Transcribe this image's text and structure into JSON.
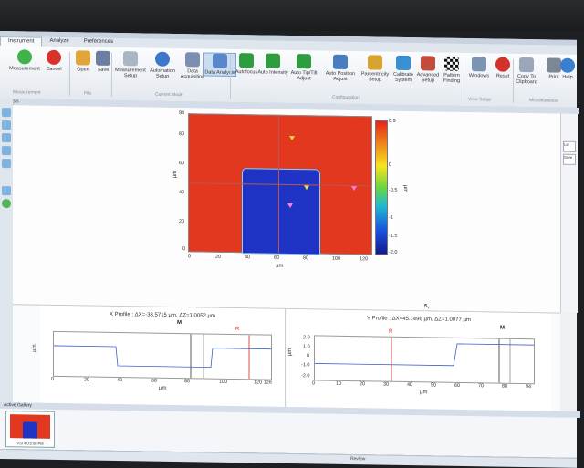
{
  "ribbon": {
    "tabs": [
      "Instrument",
      "Analyze",
      "Preferences"
    ],
    "buttons": [
      {
        "id": "measurement",
        "label": "Measurement"
      },
      {
        "id": "cancel",
        "label": "Cancel"
      },
      {
        "id": "open",
        "label": "Open"
      },
      {
        "id": "save",
        "label": "Save"
      },
      {
        "id": "measurement-setup",
        "label": "Measurement Setup"
      },
      {
        "id": "automation-setup",
        "label": "Automation Setup"
      },
      {
        "id": "data-acquisition",
        "label": "Data Acquisition"
      },
      {
        "id": "data-analysis",
        "label": "Data Analysis"
      },
      {
        "id": "autofocus",
        "label": "Autofocus"
      },
      {
        "id": "auto-intensity",
        "label": "Auto Intensity"
      },
      {
        "id": "auto-tip-tilt",
        "label": "Auto Tip/Tilt Adjust"
      },
      {
        "id": "auto-position",
        "label": "Auto Position Adjust"
      },
      {
        "id": "parcentricity",
        "label": "Parcentricity Setup"
      },
      {
        "id": "calibrate",
        "label": "Calibrate System"
      },
      {
        "id": "advanced-setup",
        "label": "Advanced Setup"
      },
      {
        "id": "pattern-finding",
        "label": "Pattern Finding"
      },
      {
        "id": "windows",
        "label": "Windows"
      },
      {
        "id": "reset",
        "label": "Reset"
      },
      {
        "id": "copy-clipboard",
        "label": "Copy To Clipboard"
      },
      {
        "id": "print",
        "label": "Print"
      },
      {
        "id": "help",
        "label": "Help"
      }
    ],
    "groups": [
      "Measurement",
      "File",
      "Current Mode",
      "Configuration",
      "View Setup",
      "Miscellaneous"
    ]
  },
  "view_header": "Analysis",
  "right_panel": {
    "btn1": "Lat",
    "btn2": "Save"
  },
  "heatmap": {
    "y_axis_label": "µm",
    "x_axis_label": "µm",
    "y_ticks": [
      "94",
      "80",
      "60",
      "40",
      "20",
      "0"
    ],
    "x_ticks": [
      "0",
      "20",
      "40",
      "60",
      "80",
      "100",
      "120"
    ],
    "colorbar_ticks": [
      "0.9",
      "0",
      "-0.5",
      "-1",
      "-1.5",
      "-2.0"
    ],
    "colorbar_label": "µm"
  },
  "x_profile": {
    "title": "X Profile : ΔX=-33.5715 µm, ΔZ=1.0052 µm",
    "x_ticks": [
      "0",
      "20",
      "40",
      "60",
      "80",
      "100",
      "120 126"
    ],
    "y_ticks": [
      "0.5",
      "0",
      "-0.5",
      "-1.0",
      "-1.5",
      "-2.0"
    ],
    "x_label": "µm",
    "y_label": "µm",
    "marker_m": "M",
    "marker_r": "R"
  },
  "y_profile": {
    "title": "Y Profile : ΔX=45.1496 µm, ΔZ=1.0077 µm",
    "x_ticks": [
      "0",
      "10",
      "20",
      "30",
      "40",
      "50",
      "60",
      "70",
      "80",
      "94"
    ],
    "y_ticks": [
      "2.0",
      "1.5",
      "1.0",
      "0.5",
      "0",
      "-0.5",
      "-1.0",
      "-1.5",
      "-2.0"
    ],
    "x_label": "µm",
    "y_label": "µm",
    "marker_m": "M",
    "marker_r": "R"
  },
  "gallery": {
    "header": "Active Gallery",
    "thumb_caption": "VSI 4:0:5:08 PM"
  },
  "status": {
    "text": "Review"
  },
  "colors": {
    "surface": "#e2381f",
    "pillar": "#1f34c4",
    "accent": "#7ea6d4"
  }
}
